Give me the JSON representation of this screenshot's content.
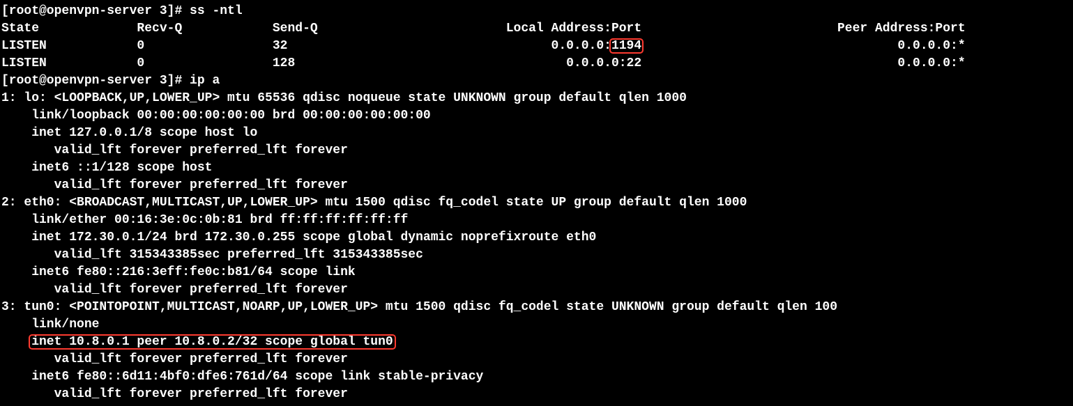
{
  "prompt": "[root@openvpn-server 3]# ",
  "cmd1": "ss -ntl",
  "ss_header": {
    "state": "State",
    "recvq": "Recv-Q",
    "sendq": "Send-Q",
    "local": "Local Address:Port",
    "peer": "Peer Address:Port"
  },
  "ss_rows": [
    {
      "state": "LISTEN",
      "recvq": "0",
      "sendq": "32",
      "local": "0.0.0.0:1194",
      "peer": "0.0.0.0:*"
    },
    {
      "state": "LISTEN",
      "recvq": "0",
      "sendq": "128",
      "local": "0.0.0.0:22",
      "peer": "0.0.0.0:*"
    }
  ],
  "cmd2": "ip a",
  "ip_lines": [
    "1: lo: <LOOPBACK,UP,LOWER_UP> mtu 65536 qdisc noqueue state UNKNOWN group default qlen 1000",
    "    link/loopback 00:00:00:00:00:00 brd 00:00:00:00:00:00",
    "    inet 127.0.0.1/8 scope host lo",
    "       valid_lft forever preferred_lft forever",
    "    inet6 ::1/128 scope host ",
    "       valid_lft forever preferred_lft forever",
    "2: eth0: <BROADCAST,MULTICAST,UP,LOWER_UP> mtu 1500 qdisc fq_codel state UP group default qlen 1000",
    "    link/ether 00:16:3e:0c:0b:81 brd ff:ff:ff:ff:ff:ff",
    "    inet 172.30.0.1/24 brd 172.30.0.255 scope global dynamic noprefixroute eth0",
    "       valid_lft 315343385sec preferred_lft 315343385sec",
    "    inet6 fe80::216:3eff:fe0c:b81/64 scope link ",
    "       valid_lft forever preferred_lft forever",
    "3: tun0: <POINTOPOINT,MULTICAST,NOARP,UP,LOWER_UP> mtu 1500 qdisc fq_codel state UNKNOWN group default qlen 100",
    "    link/none ",
    "    inet 10.8.0.1 peer 10.8.0.2/32 scope global tun0",
    "       valid_lft forever preferred_lft forever",
    "    inet6 fe80::6d11:4bf0:dfe6:761d/64 scope link stable-privacy ",
    "       valid_lft forever preferred_lft forever"
  ],
  "highlights": {
    "port_1194": "1194",
    "tun0_inet": "inet 10.8.0.1 peer 10.8.0.2/32 scope global tun0"
  }
}
